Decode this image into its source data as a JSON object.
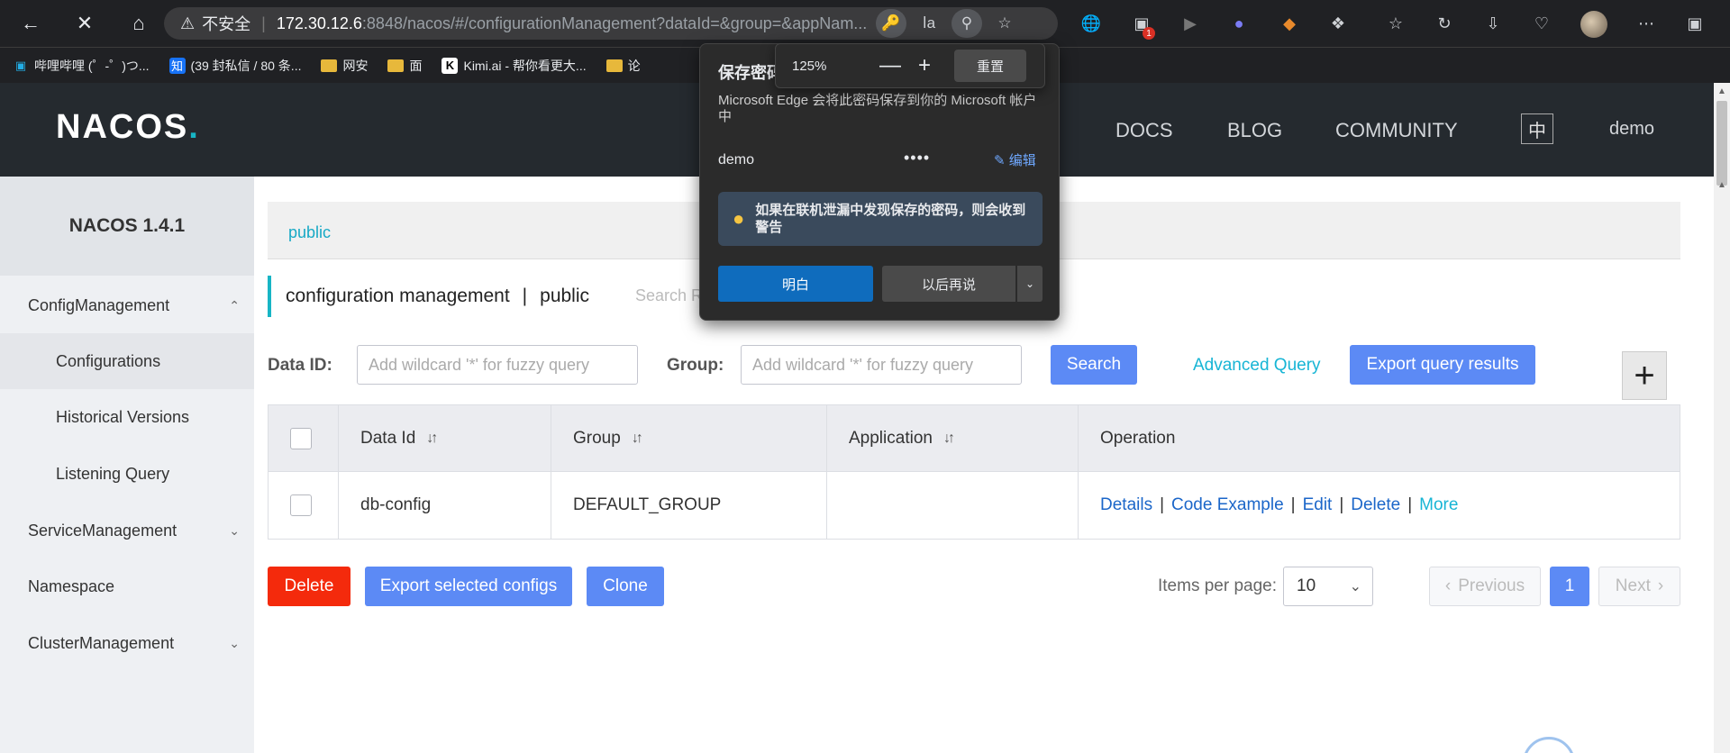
{
  "browser": {
    "insecure_label": "不安全",
    "host": "172.30.12.6",
    "path": ":8848/nacos/#/configurationManagement?dataId=&group=&appNam...",
    "accent": "#202124"
  },
  "bookmarks": [
    {
      "label": "哔哩哔哩 (゜-゜)つ...",
      "icon": "bilibili-icon"
    },
    {
      "label": "(39 封私信 / 80 条...",
      "icon": "zhihu-icon"
    },
    {
      "label": "网安",
      "icon": "folder-icon"
    },
    {
      "label": "面",
      "icon": "folder-icon"
    },
    {
      "label": "Kimi.ai - 帮你看更大...",
      "icon": "kimi-icon"
    },
    {
      "label": "论",
      "icon": "folder-icon"
    }
  ],
  "header": {
    "logo": "NACOS",
    "logo_dot": ".",
    "nav": [
      "DOCS",
      "BLOG",
      "COMMUNITY"
    ],
    "lang": "中",
    "user": "demo"
  },
  "sidebar": {
    "title": "NACOS 1.4.1",
    "items": [
      {
        "label": "ConfigManagement"
      },
      {
        "label": "Configurations"
      },
      {
        "label": "Historical Versions"
      },
      {
        "label": "Listening Query"
      },
      {
        "label": "ServiceManagement"
      },
      {
        "label": "Namespace"
      },
      {
        "label": "ClusterManagement"
      }
    ]
  },
  "main": {
    "namespace": "public",
    "page_title": "configuration management",
    "page_sep": "|",
    "page_ns": "public",
    "search_ghost": "Search R",
    "filters": {
      "dataid_label": "Data ID:",
      "dataid_placeholder": "Add wildcard '*' for fuzzy query",
      "group_label": "Group:",
      "group_placeholder": "Add wildcard '*' for fuzzy query",
      "search_btn": "Search",
      "advanced": "Advanced Query",
      "export_results": "Export query results",
      "plus": "+"
    },
    "table": {
      "headers": [
        "Data Id",
        "Group",
        "Application",
        "Operation"
      ],
      "rows": [
        {
          "data_id": "db-config",
          "group": "DEFAULT_GROUP",
          "application": ""
        }
      ],
      "ops": [
        "Details",
        "Code Example",
        "Edit",
        "Delete",
        "More"
      ]
    },
    "actions": {
      "delete": "Delete",
      "export_selected": "Export selected configs",
      "clone": "Clone"
    },
    "pager": {
      "label": "Items per page:",
      "per_page": "10",
      "prev": "Previous",
      "current": "1",
      "next": "Next"
    }
  },
  "zoom_popup": {
    "percent": "125%",
    "minus": "—",
    "plus": "+",
    "reset": "重置"
  },
  "password_popup": {
    "title": "保存密码",
    "desc": "Microsoft Edge 会将此密码保存到你的 Microsoft 帐户中",
    "user": "demo",
    "masked": "••••",
    "edit": "编辑",
    "warning": "如果在联机泄漏中发现保存的密码，则会收到警告",
    "ok": "明白",
    "later": "以后再说"
  }
}
